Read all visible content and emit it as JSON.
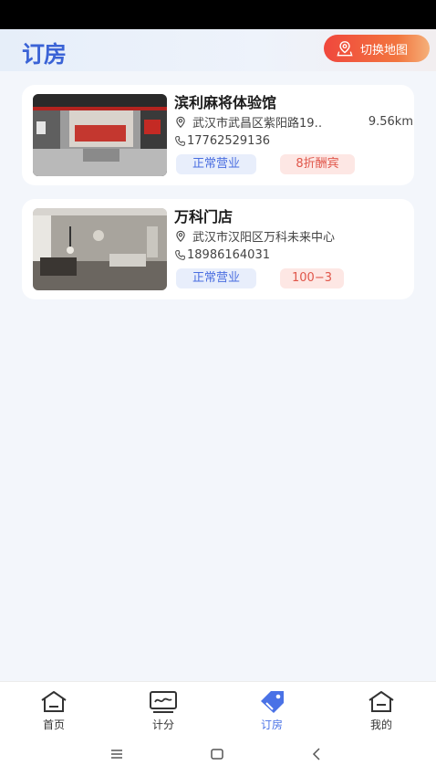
{
  "header": {
    "title": "订房",
    "map_switch_label": "切换地图"
  },
  "stores": [
    {
      "name": "滨利麻将体验馆",
      "address": "武汉市武昌区紫阳路19‥",
      "distance": "9.56km",
      "phone": "17762529136",
      "status": "正常营业",
      "promo": "8折酬宾"
    },
    {
      "name": "万科门店",
      "address": "武汉市汉阳区万科未来中心",
      "distance": "",
      "phone": "18986164031",
      "status": "正常营业",
      "promo": "100−3"
    }
  ],
  "tabbar": {
    "items": [
      {
        "label": "首页",
        "icon": "home-icon",
        "active": false
      },
      {
        "label": "计分",
        "icon": "scoreboard-icon",
        "active": false
      },
      {
        "label": "订房",
        "icon": "tag-icon",
        "active": true
      },
      {
        "label": "我的",
        "icon": "profile-home-icon",
        "active": false
      }
    ]
  },
  "colors": {
    "accent": "#4a72e6",
    "brand_title": "#3b63d6",
    "map_button": "#f0473d",
    "promo_text": "#e0564a"
  }
}
